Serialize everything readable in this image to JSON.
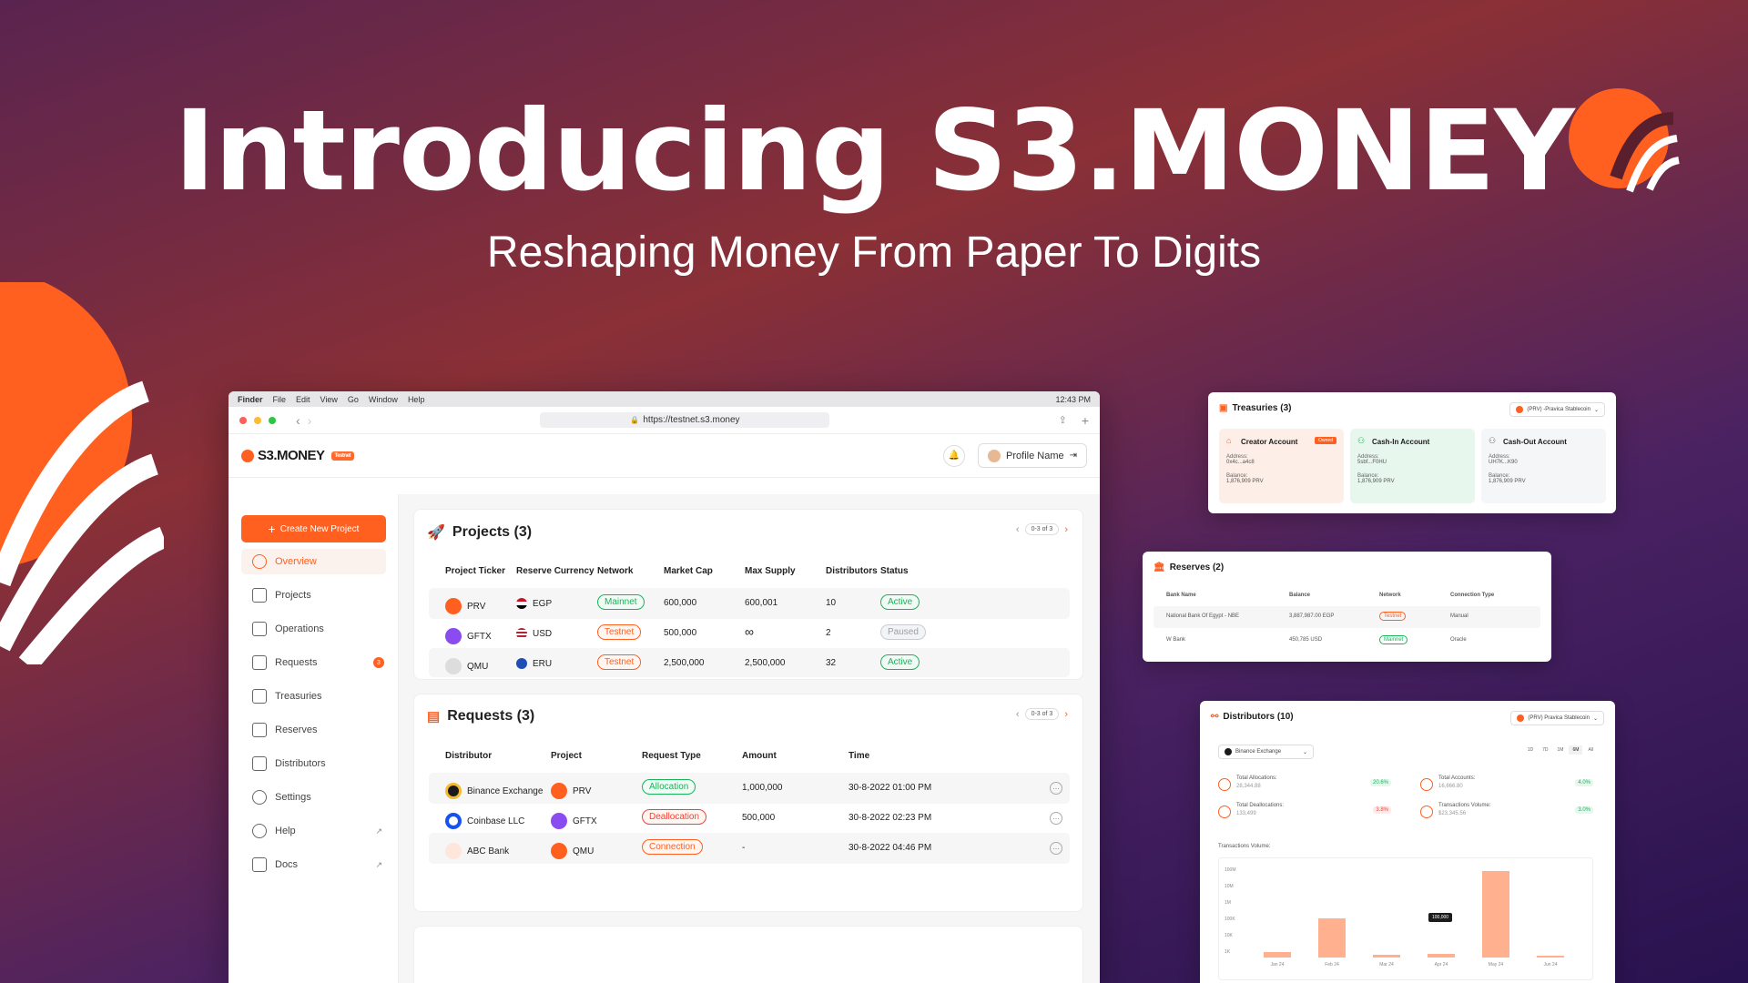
{
  "hero": {
    "title": "Introducing S3.MONEY",
    "subtitle": "Reshaping Money From Paper To Digits"
  },
  "menubar": {
    "items": [
      "Finder",
      "File",
      "Edit",
      "View",
      "Go",
      "Window",
      "Help"
    ],
    "time": "12:43 PM"
  },
  "browser": {
    "url": "https://testnet.s3.money"
  },
  "app": {
    "logo": "S3.MONEY",
    "badge": "Testnet",
    "profile": "Profile Name"
  },
  "sidebar": {
    "create_label": "Create New Project",
    "items": [
      {
        "label": "Overview",
        "active": true
      },
      {
        "label": "Projects"
      },
      {
        "label": "Operations"
      },
      {
        "label": "Requests",
        "count": "3"
      },
      {
        "label": "Treasuries"
      },
      {
        "label": "Reserves"
      },
      {
        "label": "Distributors"
      },
      {
        "label": "Settings"
      },
      {
        "label": "Help",
        "external": true
      },
      {
        "label": "Docs",
        "external": true
      }
    ]
  },
  "projects": {
    "title": "Projects (3)",
    "pager": "0-3 of 3",
    "columns": [
      "Project Ticker",
      "Reserve Currency",
      "Network",
      "Market Cap",
      "Max Supply",
      "Distributors",
      "Status"
    ],
    "rows": [
      {
        "ticker": "PRV",
        "currency": "EGP",
        "network": "Mainnet",
        "market_cap": "600,000",
        "max_supply": "600,001",
        "distributors": "10",
        "status": "Active"
      },
      {
        "ticker": "GFTX",
        "currency": "USD",
        "network": "Testnet",
        "market_cap": "500,000",
        "max_supply": "∞",
        "distributors": "2",
        "status": "Paused"
      },
      {
        "ticker": "QMU",
        "currency": "ERU",
        "network": "Testnet",
        "market_cap": "2,500,000",
        "max_supply": "2,500,000",
        "distributors": "32",
        "status": "Active"
      }
    ]
  },
  "requests": {
    "title": "Requests (3)",
    "pager": "0-3 of 3",
    "columns": [
      "Distributor",
      "Project",
      "Request Type",
      "Amount",
      "Time"
    ],
    "rows": [
      {
        "distributor": "Binance Exchange",
        "project": "PRV",
        "type": "Allocation",
        "amount": "1,000,000",
        "time": "30-8-2022 01:00 PM"
      },
      {
        "distributor": "Coinbase LLC",
        "project": "GFTX",
        "type": "Deallocation",
        "amount": "500,000",
        "time": "30-8-2022 02:23 PM"
      },
      {
        "distributor": "ABC Bank",
        "project": "QMU",
        "type": "Connection",
        "amount": "-",
        "time": "30-8-2022 04:46 PM"
      }
    ]
  },
  "treasuries": {
    "title": "Treasuries (3)",
    "selector": "(PRV) -Pravica Stablecoin",
    "cards": [
      {
        "name": "Creator Account",
        "tag": "Owned",
        "address": "0x4c...a4c8",
        "balance": "1,876,909 PRV"
      },
      {
        "name": "Cash-In Account",
        "address": "5sbf...F0HU",
        "balance": "1,876,909 PRV"
      },
      {
        "name": "Cash-Out Account",
        "address": "UH7K...K90",
        "balance": "1,876,909 PRV"
      }
    ],
    "address_label": "Address:",
    "balance_label": "Balance:"
  },
  "reserves": {
    "title": "Reserves (2)",
    "columns": [
      "Bank Name",
      "Balance",
      "Network",
      "Connection Type"
    ],
    "rows": [
      {
        "bank": "National Bank Of Egypt - NBE",
        "balance": "3,887,987.00 EGP",
        "network": "Testnet",
        "type": "Manual"
      },
      {
        "bank": "W Bank",
        "balance": "450,785 USD",
        "network": "Mainnet",
        "type": "Oracle"
      }
    ]
  },
  "distributors": {
    "title": "Distributors (10)",
    "selector": "(PRV) Pravica Stablecoin",
    "filter": "Binance Exchange",
    "ranges": [
      "1D",
      "7D",
      "1M",
      "6M",
      "All"
    ],
    "stats": [
      {
        "label": "Total Allocations:",
        "value": "28,344.88",
        "delta": "20.6%",
        "dir": "up"
      },
      {
        "label": "Total Accounts:",
        "value": "16,666.80",
        "delta": "4.0%",
        "dir": "up"
      },
      {
        "label": "Total Deallocations:",
        "value": "133,499",
        "delta": "3.8%",
        "dir": "down"
      },
      {
        "label": "Transactions Volume:",
        "value": "$23,345.56",
        "delta": "3.0%",
        "dir": "up"
      }
    ],
    "chart_title": "Transactions Volume:",
    "chart_data": {
      "type": "bar",
      "categories": [
        "Jan 24",
        "Feb 24",
        "Mar 24",
        "Apr 24",
        "May 24",
        "Jun 24"
      ],
      "values": [
        3.8,
        27,
        1.9,
        2.5,
        60,
        1.1
      ],
      "yticks": [
        "100M",
        "10M",
        "1M",
        "100K",
        "10K",
        "1K"
      ],
      "tooltip": "100,000",
      "color": "#ffb08e"
    }
  }
}
